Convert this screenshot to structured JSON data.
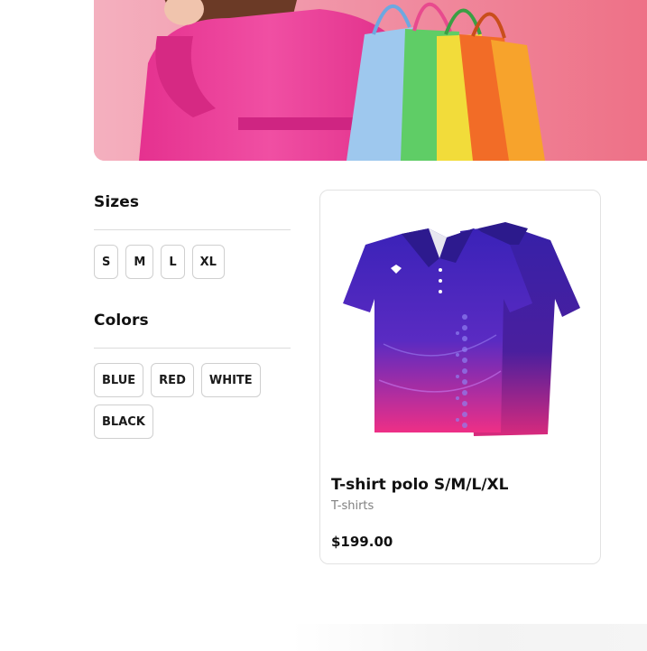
{
  "hero": {
    "image": "woman-holding-shopping-bags",
    "background_color": "#ee7a8e"
  },
  "filters": {
    "sizes": {
      "title": "Sizes",
      "options": [
        "S",
        "M",
        "L",
        "XL"
      ]
    },
    "colors": {
      "title": "Colors",
      "options": [
        "BLUE",
        "RED",
        "WHITE",
        "BLACK"
      ]
    }
  },
  "product": {
    "image": "purple-polo-tshirt",
    "name": "T-shirt polo S/M/L/XL",
    "category": "T-shirts",
    "price": "$199.00",
    "colors": {
      "shirt_top": "#3a22b8",
      "shirt_bottom": "#ee2f86"
    }
  }
}
